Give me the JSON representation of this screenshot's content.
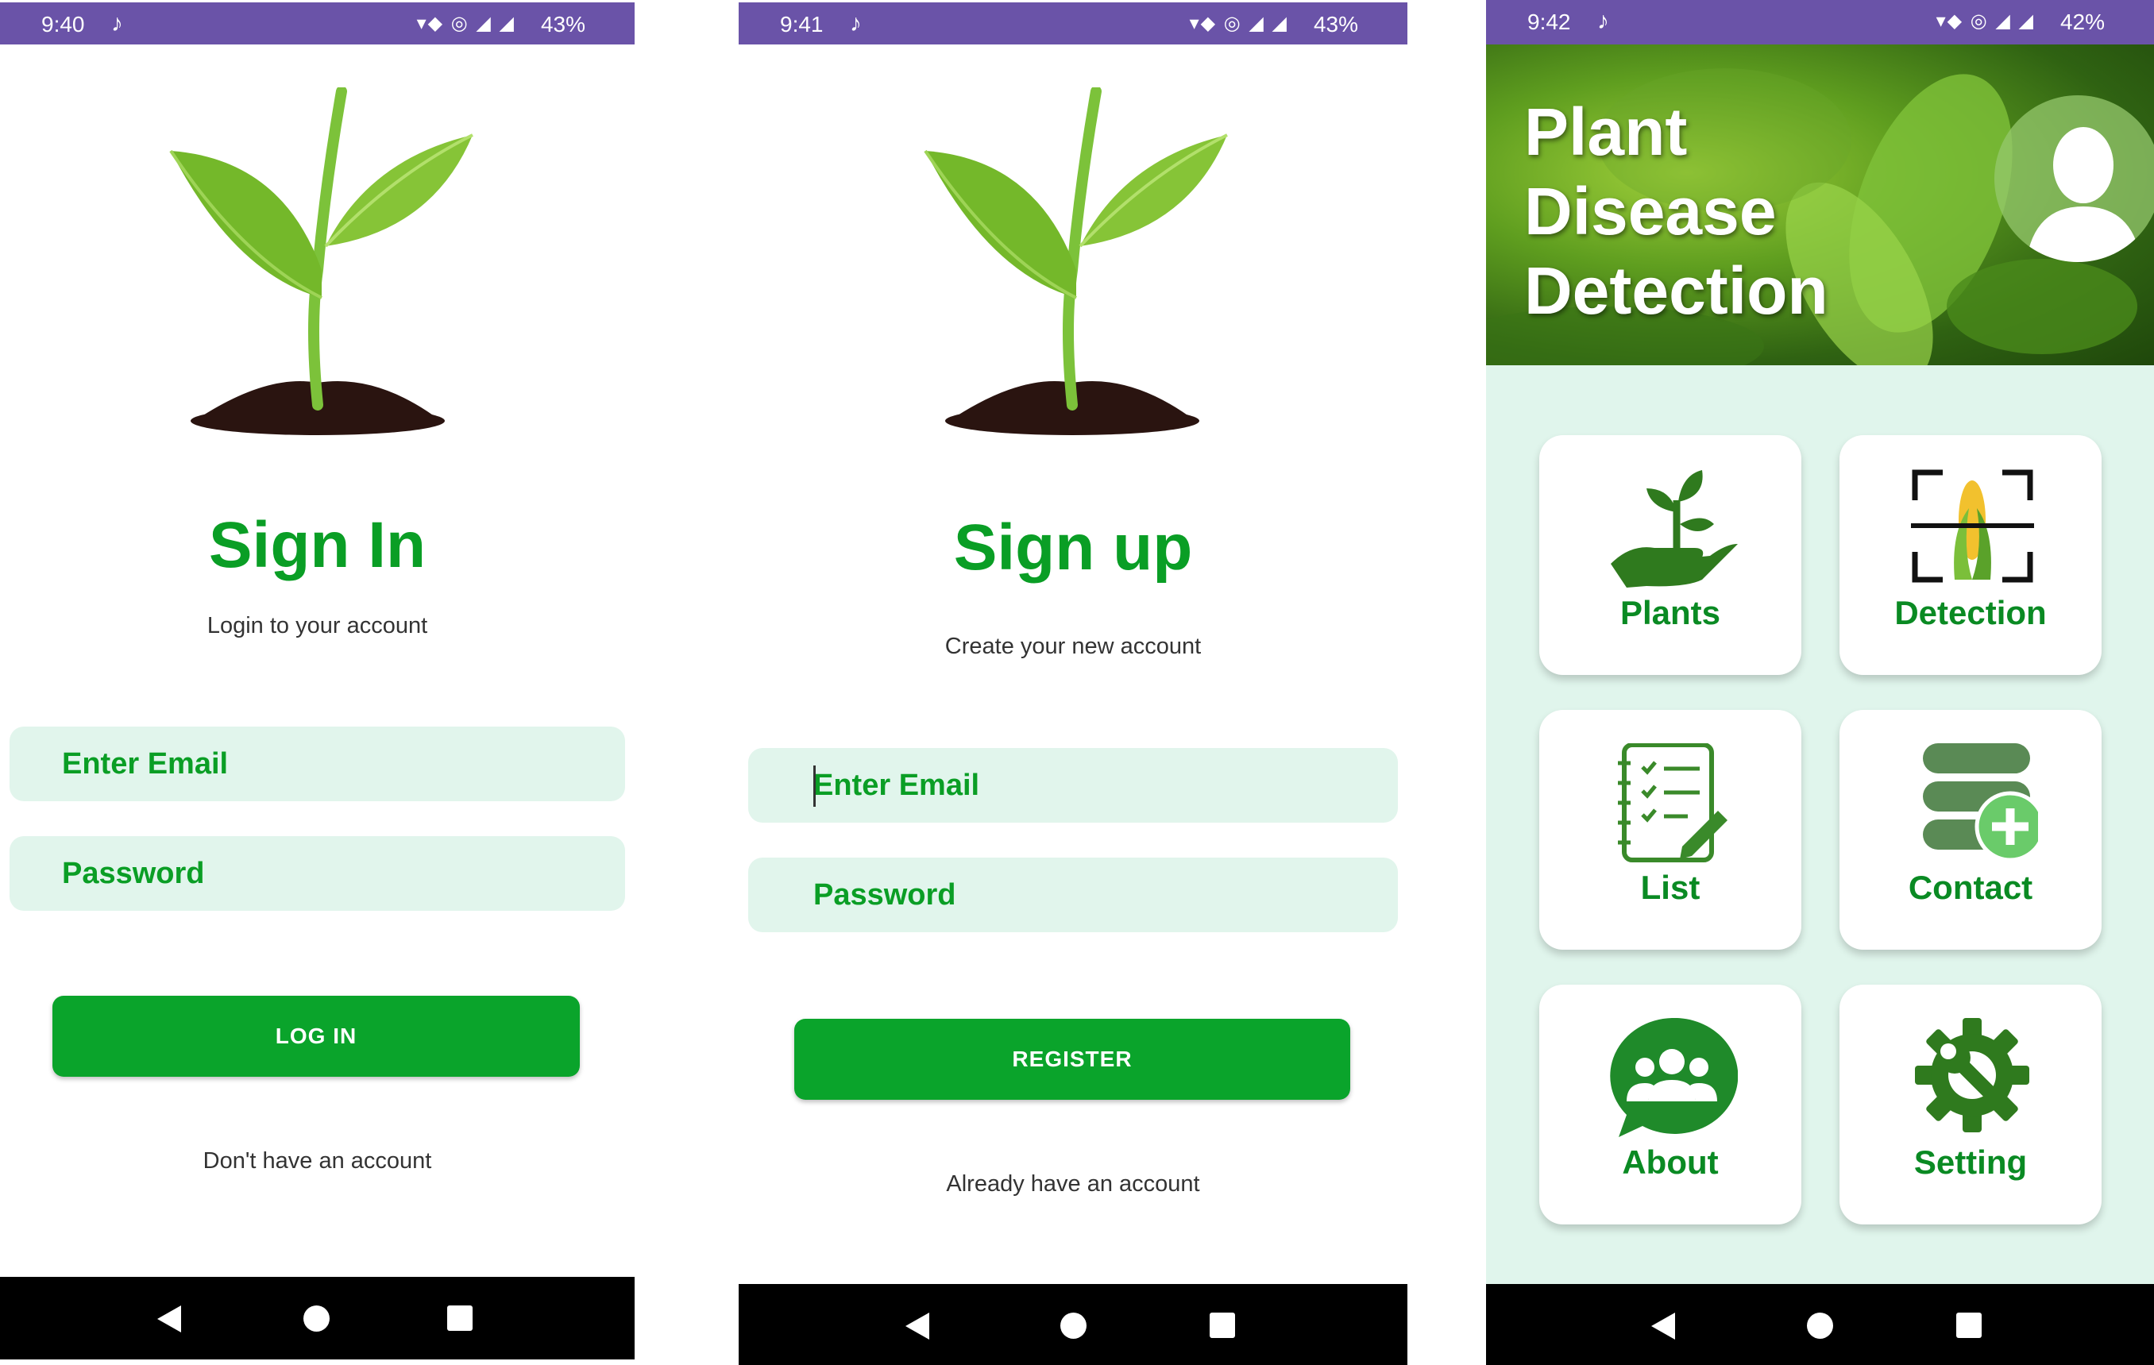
{
  "signin_screen": {
    "status": {
      "time": "9:40",
      "battery": "43%"
    },
    "title": "Sign In",
    "subtitle": "Login to your account",
    "email_placeholder": "Enter Email",
    "password_placeholder": "Password",
    "login_button": "LOG IN",
    "register_link": "Don't have an account"
  },
  "signup_screen": {
    "status": {
      "time": "9:41",
      "battery": "43%"
    },
    "title": "Sign up",
    "subtitle": "Create your new account",
    "email_placeholder": "Enter Email",
    "password_placeholder": "Password",
    "register_button": "REGISTER",
    "login_link": "Already have an account"
  },
  "home_screen": {
    "status": {
      "time": "9:42",
      "battery": "42%"
    },
    "header_title": [
      "Plant",
      "Disease",
      "Detection"
    ],
    "menu": [
      {
        "label": "Plants",
        "icon": "plant-hand-icon"
      },
      {
        "label": "Detection",
        "icon": "scan-corn-icon"
      },
      {
        "label": "List",
        "icon": "checklist-icon"
      },
      {
        "label": "Contact",
        "icon": "database-add-icon"
      },
      {
        "label": "About",
        "icon": "people-chat-icon"
      },
      {
        "label": "Setting",
        "icon": "gear-wrench-icon"
      }
    ]
  },
  "colors": {
    "primary_green": "#0aa42b",
    "status_bar": "#6a53a8",
    "field_background": "#e1f5ec",
    "home_background": "#e0f5ec"
  }
}
